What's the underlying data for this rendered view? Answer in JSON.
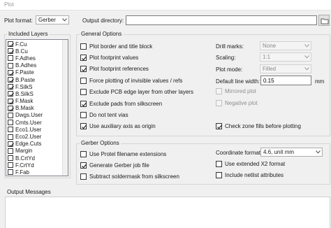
{
  "window": {
    "title": "Plot"
  },
  "top": {
    "plot_format_label": "Plot format:",
    "plot_format_value": "Gerber",
    "output_directory_label": "Output directory:",
    "output_directory_value": ""
  },
  "layers": {
    "title": "Included Layers",
    "items": [
      {
        "name": "F.Cu",
        "checked": true
      },
      {
        "name": "B.Cu",
        "checked": true
      },
      {
        "name": "F.Adhes",
        "checked": false
      },
      {
        "name": "B.Adhes",
        "checked": false
      },
      {
        "name": "F.Paste",
        "checked": true
      },
      {
        "name": "B.Paste",
        "checked": true
      },
      {
        "name": "F.SilkS",
        "checked": true
      },
      {
        "name": "B.SilkS",
        "checked": true
      },
      {
        "name": "F.Mask",
        "checked": true
      },
      {
        "name": "B.Mask",
        "checked": true
      },
      {
        "name": "Dwgs.User",
        "checked": false
      },
      {
        "name": "Cmts.User",
        "checked": false
      },
      {
        "name": "Eco1.User",
        "checked": false
      },
      {
        "name": "Eco2.User",
        "checked": false
      },
      {
        "name": "Edge.Cuts",
        "checked": true
      },
      {
        "name": "Margin",
        "checked": false
      },
      {
        "name": "B.CrtYd",
        "checked": false
      },
      {
        "name": "F.CrtYd",
        "checked": false
      },
      {
        "name": "F.Fab",
        "checked": false
      }
    ]
  },
  "general": {
    "title": "General Options",
    "options": [
      {
        "label": "Plot border and title block",
        "checked": false
      },
      {
        "label": "Plot footprint values",
        "checked": true
      },
      {
        "label": "Plot footprint references",
        "checked": true
      },
      {
        "label": "Force plotting of invisible values / refs",
        "checked": false
      },
      {
        "label": "Exclude PCB edge layer from other layers",
        "checked": false
      },
      {
        "label": "Exclude pads from silkscreen",
        "checked": true
      },
      {
        "label": "Do not tent vias",
        "checked": false
      },
      {
        "label": "Use auxiliary axis as origin",
        "checked": true
      }
    ],
    "drill_marks_label": "Drill marks:",
    "drill_marks_value": "None",
    "scaling_label": "Scaling:",
    "scaling_value": "1:1",
    "plot_mode_label": "Plot mode:",
    "plot_mode_value": "Filled",
    "line_width_label": "Default line width:",
    "line_width_value": "0.15",
    "line_width_unit": "mm",
    "mirrored_label": "Mirrored plot",
    "negative_label": "Negative plot",
    "check_zone_label": "Check zone fills before plotting"
  },
  "gerber": {
    "title": "Gerber Options",
    "options": [
      {
        "label": "Use Protel filename extensions",
        "checked": false
      },
      {
        "label": "Generate Gerber job file",
        "checked": true
      },
      {
        "label": "Subtract soldermask from silkscreen",
        "checked": false
      }
    ],
    "coord_format_label": "Coordinate format:",
    "coord_format_value": "4.6, unit mm",
    "x2_label": "Use extended X2 format",
    "netlist_label": "Include netlist attributes"
  },
  "output": {
    "title": "Output Messages"
  }
}
